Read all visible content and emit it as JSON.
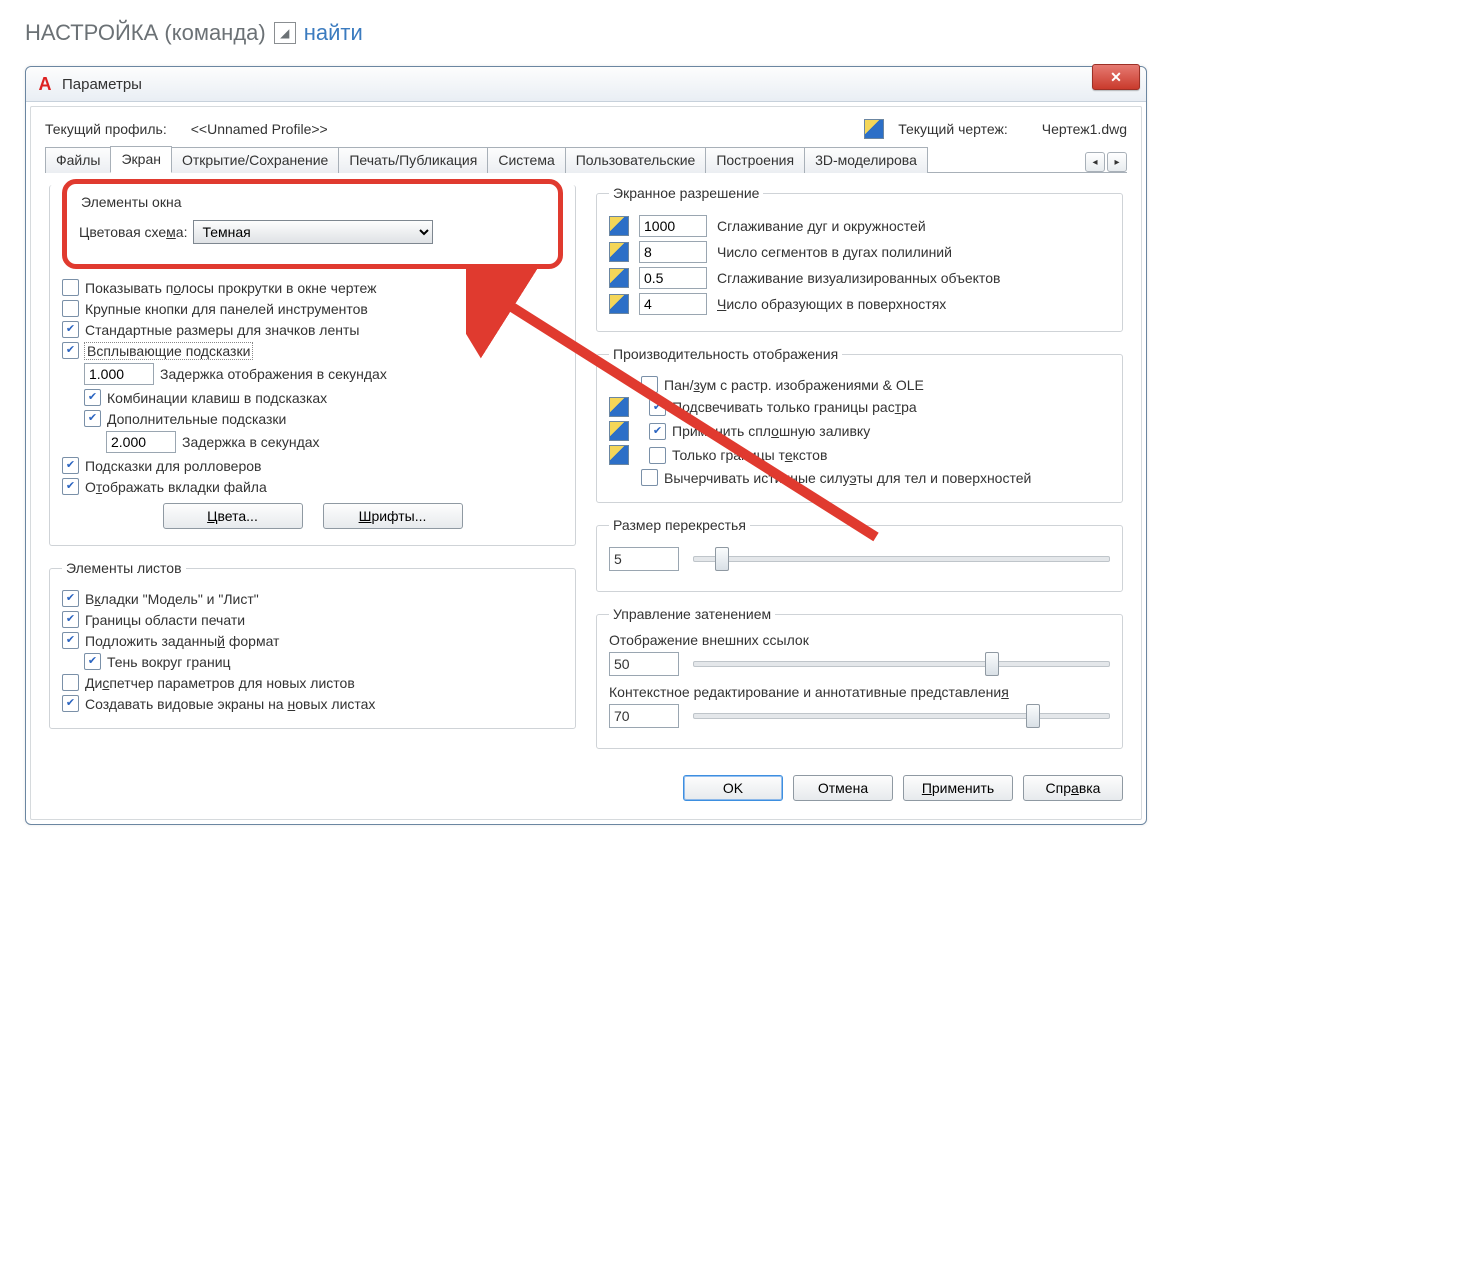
{
  "page": {
    "heading_left": "НАСТРОЙКА (команда)",
    "link": "найти"
  },
  "dialog": {
    "title": "Параметры",
    "profile_label": "Текущий профиль:",
    "profile_value": "<<Unnamed Profile>>",
    "drawing_label": "Текущий чертеж:",
    "drawing_value": "Чертеж1.dwg"
  },
  "tabs": [
    "Файлы",
    "Экран",
    "Открытие/Сохранение",
    "Печать/Публикация",
    "Система",
    "Пользовательские",
    "Построения",
    "3D-моделирова"
  ],
  "window_elements": {
    "legend": "Элементы окна",
    "scheme_label": "Цветовая схема:",
    "scheme_value": "Темная",
    "scrollbars": "Показывать полосы прокрутки в окне чертеж",
    "large_buttons": "Крупные кнопки для панелей инструментов",
    "std_ribbon": "Стандартные размеры для значков ленты",
    "tooltips": "Всплывающие подсказки",
    "tooltip_delay_val": "1.000",
    "tooltip_delay_lbl": "Задержка отображения в секундах",
    "hotkeys": "Комбинации клавиш в подсказках",
    "ext_tooltips": "Дополнительные подсказки",
    "ext_delay_val": "2.000",
    "ext_delay_lbl": "Задержка в секундах",
    "rollover": "Подсказки для ролловеров",
    "filetabs": "Отображать вкладки файла",
    "colors_btn": "Цвета...",
    "fonts_btn": "Шрифты..."
  },
  "layout_elements": {
    "legend": "Элементы листов",
    "model_layout": "Вкладки \"Модель\" и \"Лист\"",
    "print_area": "Границы области печати",
    "paper_bg": "Подложить заданный формат",
    "shadow": "Тень вокруг границ",
    "page_setup_mgr": "Диспетчер параметров для новых листов",
    "viewports": "Создавать видовые экраны на новых листах"
  },
  "resolution": {
    "legend": "Экранное разрешение",
    "arc_val": "1000",
    "arc_lbl": "Сглаживание дуг и окружностей",
    "seg_val": "8",
    "seg_lbl": "Число сегментов в дугах полилиний",
    "rend_val": "0.5",
    "rend_lbl": "Сглаживание визуализированных объектов",
    "surf_val": "4",
    "surf_lbl": "Число образующих в поверхностях"
  },
  "performance": {
    "legend": "Производительность отображения",
    "panzoom": "Пан/зум с растр. изображениями & OLE",
    "highlight_raster": "Подсвечивать только границы растра",
    "solid_fill": "Применить сплошную заливку",
    "text_frame": "Только границы текстов",
    "silhouettes": "Вычерчивать истинные силуэты для тел и поверхностей"
  },
  "crosshair": {
    "legend": "Размер перекрестья",
    "value": "5"
  },
  "fade": {
    "legend": "Управление затенением",
    "xref_lbl": "Отображение внешних ссылок",
    "xref_val": "50",
    "inplace_lbl": "Контекстное редактирование и аннотативные представления",
    "inplace_val": "70"
  },
  "buttons": {
    "ok": "OK",
    "cancel": "Отмена",
    "apply": "Применить",
    "help": "Справка"
  }
}
